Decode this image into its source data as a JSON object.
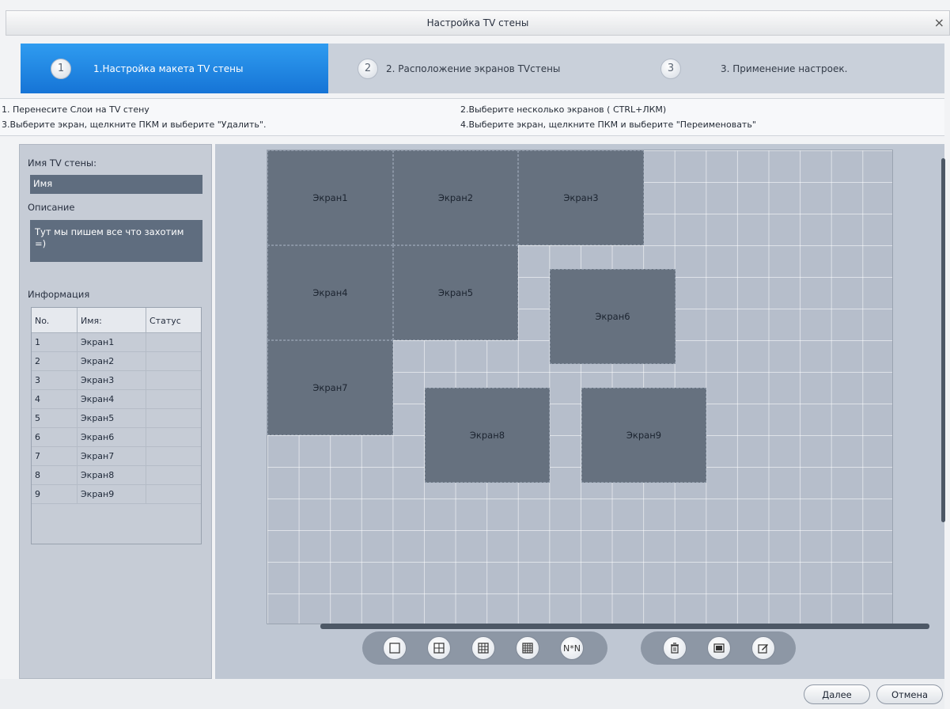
{
  "window": {
    "title": "Настройка TV стены",
    "close_icon": "×"
  },
  "steps": [
    {
      "num": "1",
      "label": "1.Настройка макета TV стены"
    },
    {
      "num": "2",
      "label": "2. Расположение экранов TVстены"
    },
    {
      "num": "3",
      "label": "3. Применение настроек."
    }
  ],
  "instructions": {
    "line1": "1. Перенесите Слои на TV стену",
    "line2": "2.Выберите несколько экранов ( CTRL+ЛКМ)",
    "line3": "3.Выберите экран, щелкните ПКМ и выберите \"Удалить\".",
    "line4": "4.Выберите экран, щелкните ПКМ и выберите \"Переименовать\""
  },
  "left": {
    "name_label": "Имя TV стены:",
    "name_value": "Имя",
    "desc_label": "Описание",
    "desc_value": "Тут мы пишем все что захотим =)",
    "info_label": "Информация",
    "columns": [
      "No.",
      "Имя:",
      "Статус"
    ],
    "rows": [
      {
        "no": "1",
        "name": "Экран1",
        "status": ""
      },
      {
        "no": "2",
        "name": "Экран2",
        "status": ""
      },
      {
        "no": "3",
        "name": "Экран3",
        "status": ""
      },
      {
        "no": "4",
        "name": "Экран4",
        "status": ""
      },
      {
        "no": "5",
        "name": "Экран5",
        "status": ""
      },
      {
        "no": "6",
        "name": "Экран6",
        "status": ""
      },
      {
        "no": "7",
        "name": "Экран7",
        "status": ""
      },
      {
        "no": "8",
        "name": "Экран8",
        "status": ""
      },
      {
        "no": "9",
        "name": "Экран9",
        "status": ""
      }
    ]
  },
  "screens": [
    "Экран1",
    "Экран2",
    "Экран3",
    "Экран4",
    "Экран5",
    "Экран6",
    "Экран7",
    "Экран8",
    "Экран9"
  ],
  "toolbar": {
    "nxn_label": "N*N"
  },
  "footer": {
    "next_label": "Далее",
    "cancel_label": "Отмена"
  }
}
